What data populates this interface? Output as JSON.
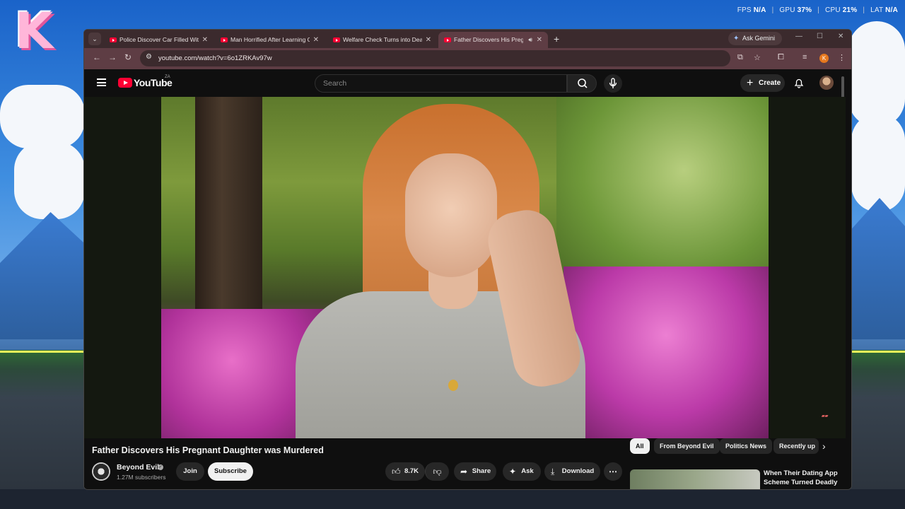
{
  "overlay": {
    "fps_label": "FPS",
    "fps_value": "N/A",
    "gpu_label": "GPU",
    "gpu_value": "37%",
    "cpu_label": "CPU",
    "cpu_value": "21%",
    "lat_label": "LAT",
    "lat_value": "N/A"
  },
  "desktop": {
    "logo_letter": "K"
  },
  "browser": {
    "tabs": [
      {
        "label": "Police Discover Car Filled With"
      },
      {
        "label": "Man Horrified After Learning G"
      },
      {
        "label": "Welfare Check Turns into Dead"
      },
      {
        "label": "Father Discovers His Pregna"
      }
    ],
    "gemini_label": "Ask Gemini",
    "url": "youtube.com/watch?v=6o1ZRKAv97w",
    "profile_initial": "K"
  },
  "youtube": {
    "logo_text": "YouTube",
    "region": "ZA",
    "search_placeholder": "Search",
    "create_label": "Create",
    "video": {
      "title": "Father Discovers His Pregnant Daughter was Murdered",
      "channel": "Beyond Evil",
      "subscribers": "1.27M subscribers",
      "join_label": "Join",
      "subscribe_label": "Subscribe",
      "likes": "8.7K",
      "share_label": "Share",
      "ask_label": "Ask",
      "download_label": "Download"
    },
    "chips": [
      "All",
      "From Beyond Evil",
      "Politics News",
      "Recently up"
    ],
    "recommendation": {
      "title": "When Their Dating App Scheme Turned Deadly"
    }
  }
}
